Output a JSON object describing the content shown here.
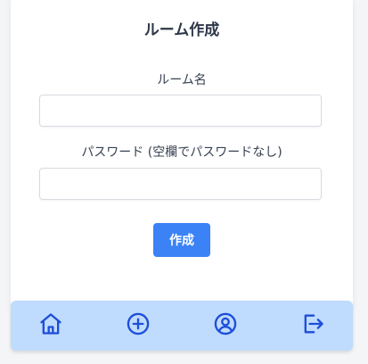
{
  "page": {
    "title": "ルーム作成"
  },
  "form": {
    "room_name_label": "ルーム名",
    "room_name_value": "",
    "password_label": "パスワード (空欄でパスワードなし)",
    "password_value": "",
    "create_label": "作成"
  },
  "nav": {
    "items": [
      {
        "icon": "home-icon"
      },
      {
        "icon": "plus-circle-icon"
      },
      {
        "icon": "user-circle-icon"
      },
      {
        "icon": "logout-icon"
      }
    ]
  },
  "colors": {
    "accent": "#3b82f6",
    "nav_background": "#bfdbfe",
    "icon": "#1d4ed8"
  }
}
